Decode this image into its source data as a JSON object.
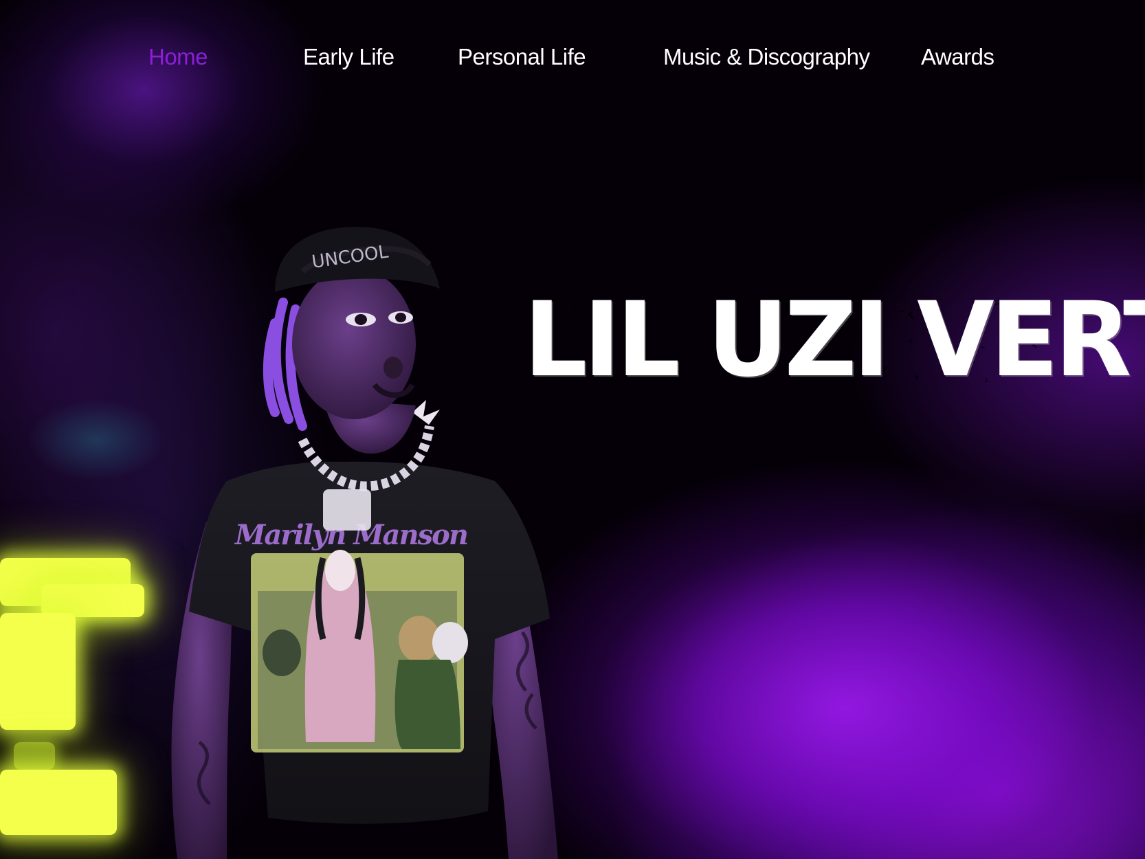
{
  "nav": {
    "items": [
      {
        "label": "Home",
        "active": true
      },
      {
        "label": "Early Life",
        "active": false
      },
      {
        "label": "Personal Life",
        "active": false
      },
      {
        "label": "Music & Discography",
        "active": false
      },
      {
        "label": "Awards",
        "active": false
      }
    ]
  },
  "hero": {
    "title": "LIL UZI VERT"
  },
  "colors": {
    "accent": "#8b1fd8",
    "nav_text": "#ffffff",
    "background": "#050008",
    "glow_purple": "#9a19e6",
    "neon_yellow": "#f3ff4a"
  }
}
